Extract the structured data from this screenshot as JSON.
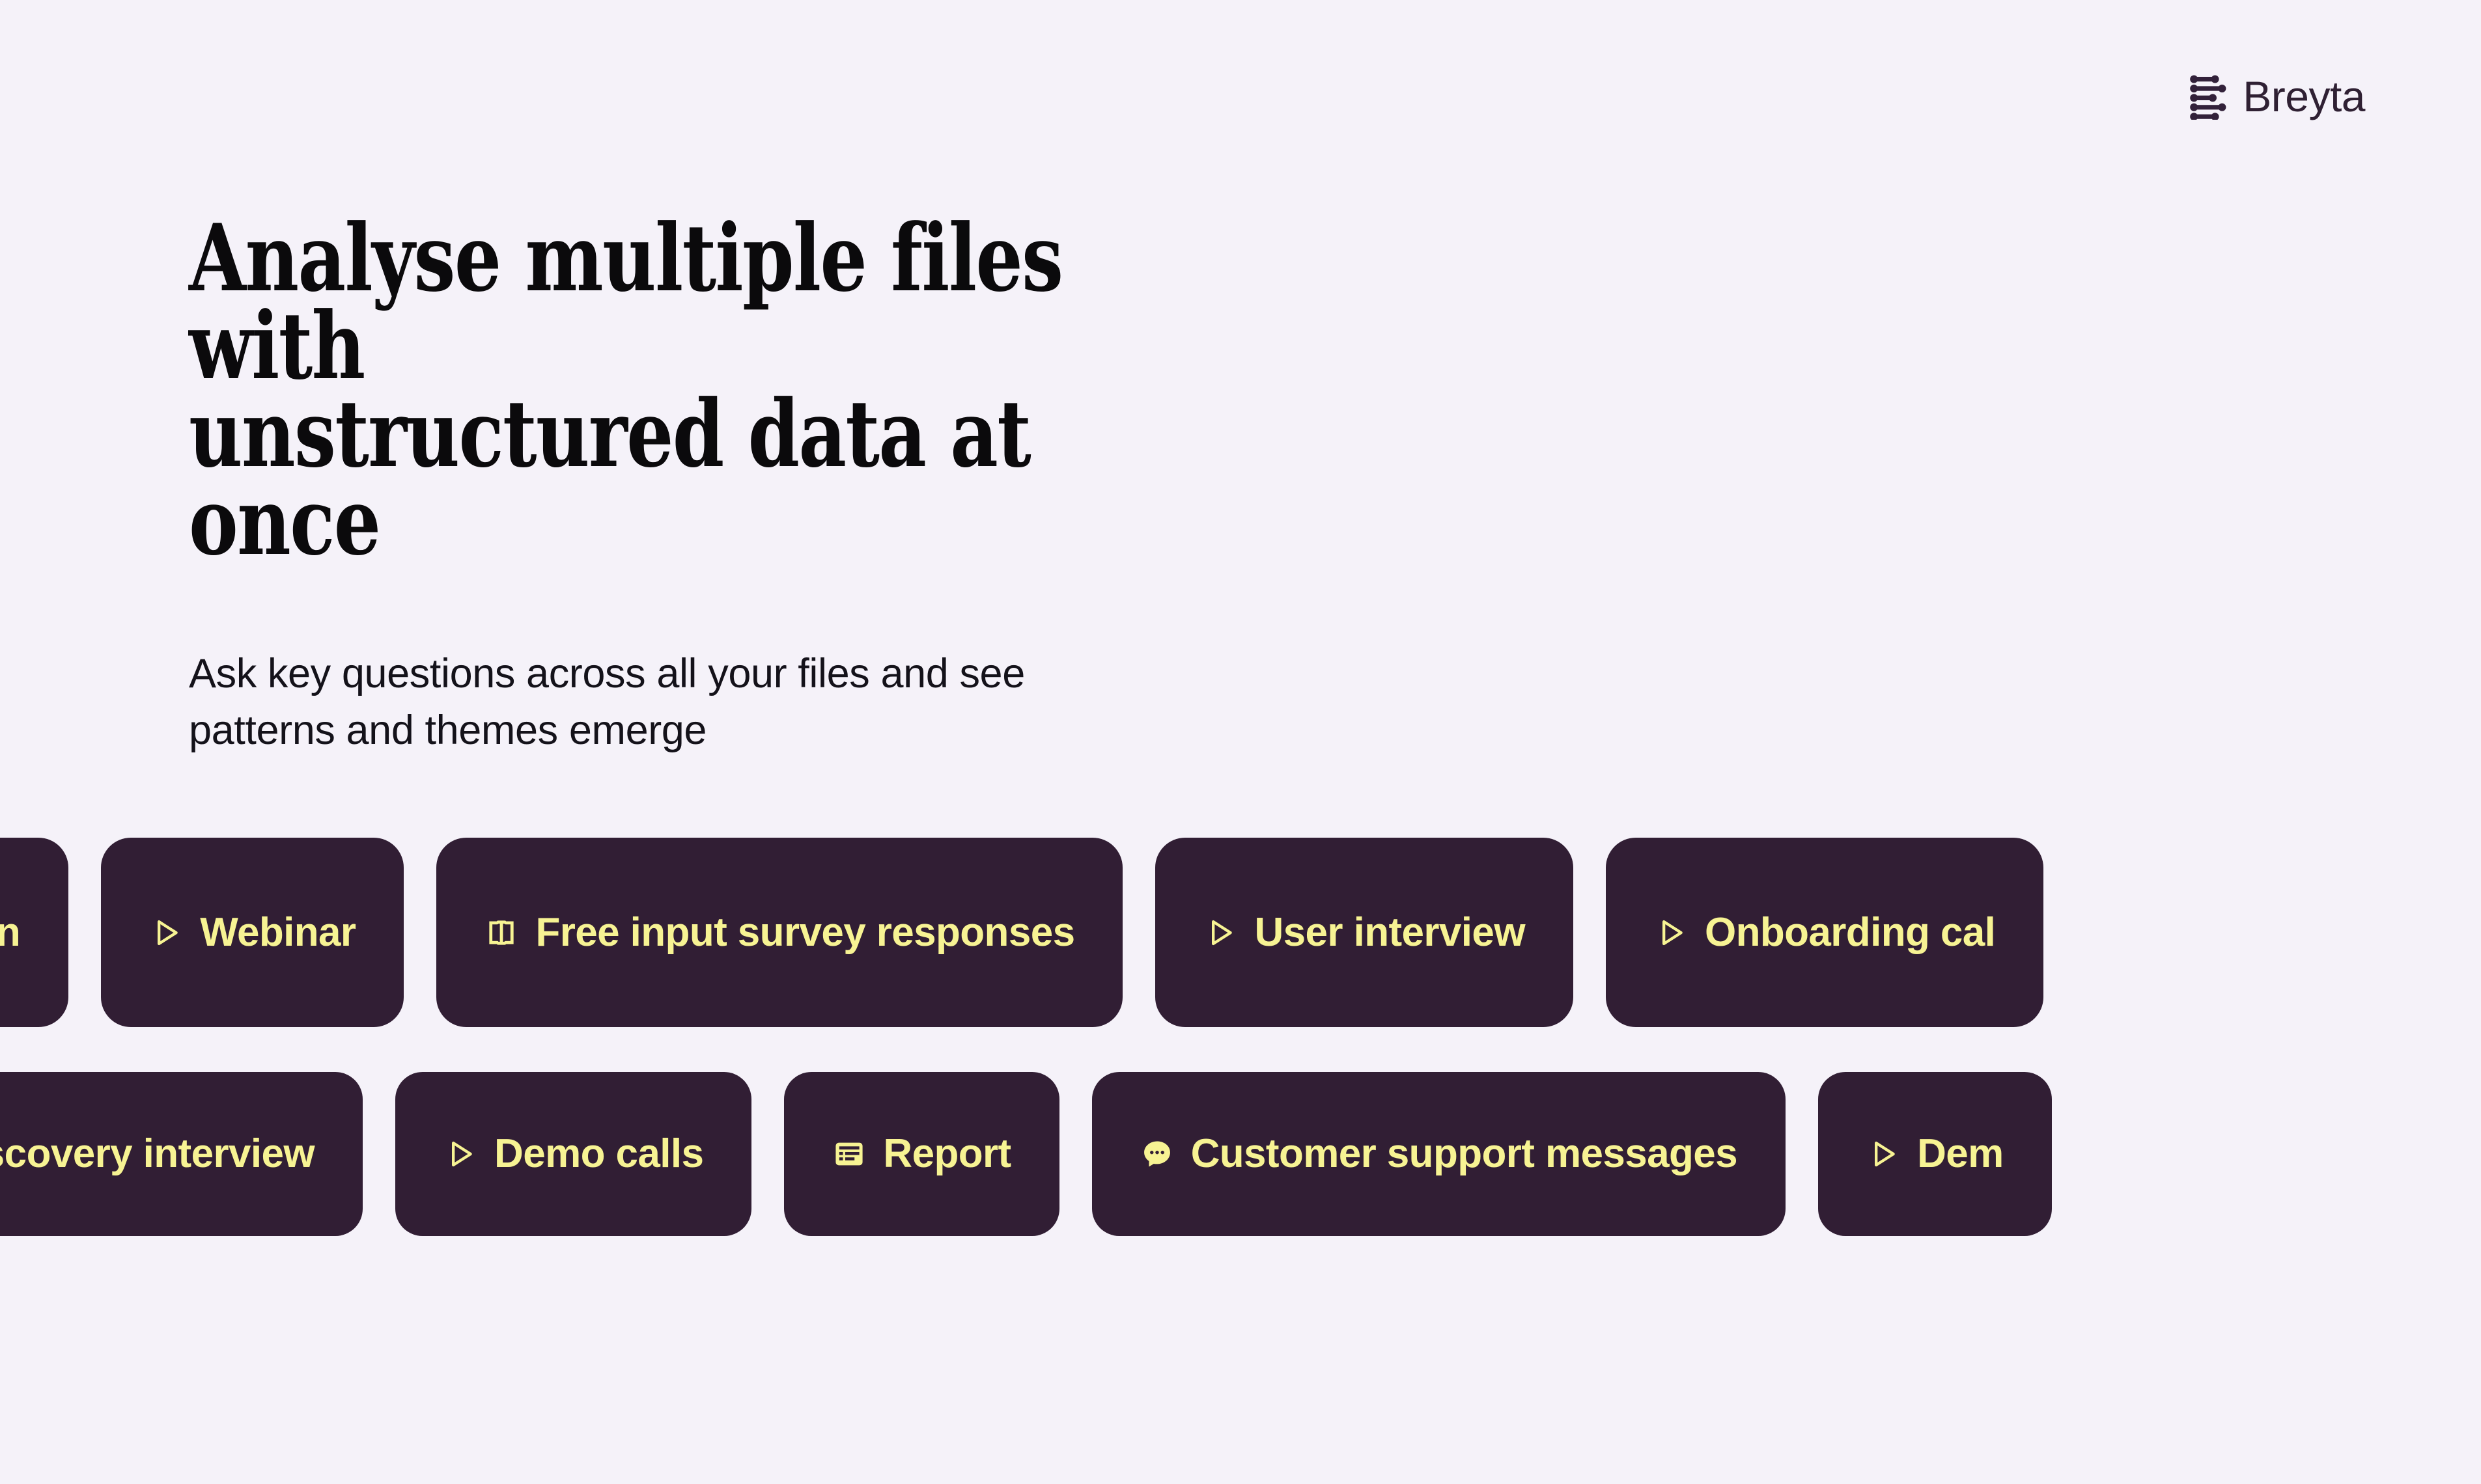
{
  "brand": {
    "name": "Breyta",
    "logo_icon": "breyta-bars-logo",
    "logo_color": "#32213a"
  },
  "hero": {
    "title": "Analyse multiple files with\nunstructured data at once",
    "subtitle": "Ask key questions across all your files and see\npatterns and themes emerge"
  },
  "theme": {
    "page_background": "#f5f2f9",
    "pill_background": "#311e34",
    "pill_text": "#f7f393",
    "heading_text": "#0b0a0c"
  },
  "marquee": {
    "rows": [
      {
        "name": "pill-row-top",
        "pills": [
          {
            "label": "k session",
            "icon": "none",
            "truncated": true
          },
          {
            "label": "Webinar",
            "icon": "play-icon"
          },
          {
            "label": "Free input survey responses",
            "icon": "text-input-cursor-icon"
          },
          {
            "label": "User interview",
            "icon": "play-icon"
          },
          {
            "label": "Onboarding cal",
            "icon": "play-icon",
            "truncated": true
          }
        ]
      },
      {
        "name": "pill-row-bottom",
        "pills": [
          {
            "label": "Discovery interview",
            "icon": "chat-bubble-icon"
          },
          {
            "label": "Demo calls",
            "icon": "play-icon"
          },
          {
            "label": "Report",
            "icon": "report-table-icon"
          },
          {
            "label": "Customer support messages",
            "icon": "chat-bubble-icon"
          },
          {
            "label": "Dem",
            "icon": "play-icon",
            "truncated": true
          }
        ]
      }
    ]
  }
}
